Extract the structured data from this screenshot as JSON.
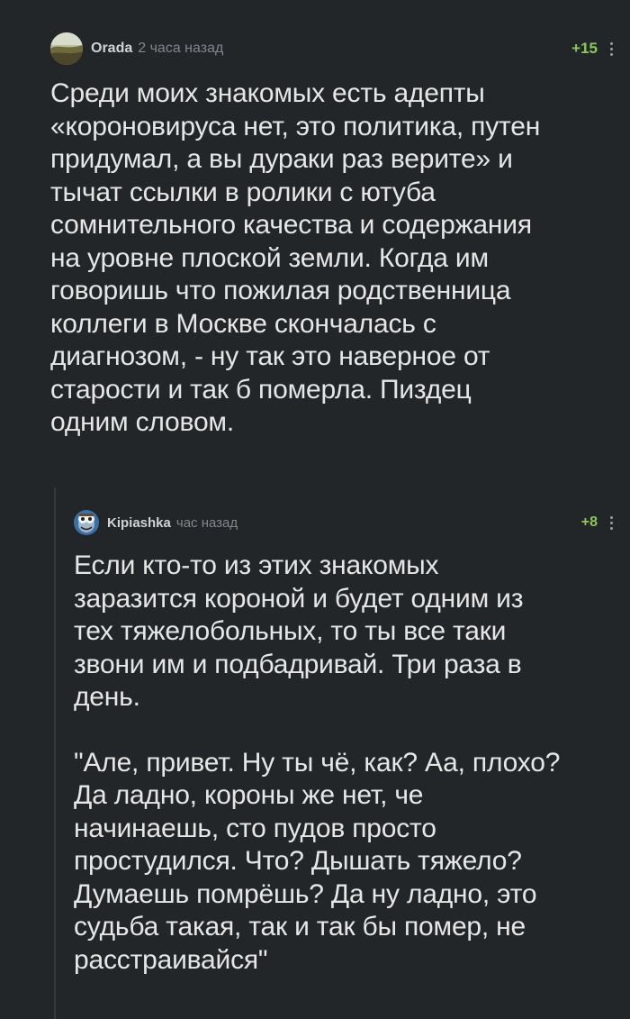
{
  "comments": [
    {
      "author": "Orada",
      "time": "2 часа назад",
      "rating": "+15",
      "avatar_icon": "landscape-avatar",
      "paragraphs": [
        "Среди моих знакомых есть адепты\n«короновируса нет, это политика, путен\nпридумал, а вы дураки раз верите» и\nтычат ссылки в ролики с ютуба\nсомнительного качества и содержания\nна уровне плоской земли. Когда им\nговоришь что пожилая родственница\nколлеги в Москве скончалась с\nдиагнозом, - ну так это наверное от\nстарости и так б померла. Пиздец\nодним словом."
      ]
    },
    {
      "author": "Kipiashka",
      "time": "час назад",
      "rating": "+8",
      "avatar_icon": "crazy-frog-avatar",
      "paragraphs": [
        "Если кто-то из этих знакомых\nзаразится короной и будет одним из\nтех тяжелобольных, то ты все таки\nзвони им и подбадривай. Три раза в\nдень.",
        "\"Але, привет. Ну ты чё, как? Аа, плохо?\nДа ладно, короны же нет, че\nначинаешь, сто пудов просто\nпростудился. Что? Дышать тяжело?\nДумаешь помрёшь? Да ну ладно, это\nсудьба такая, так и так бы помер, не\nрасстраивайся\""
      ]
    }
  ],
  "colors": {
    "background": "#232629",
    "text": "#e6e6e6",
    "rating": "#8ac858",
    "meta": "#81868b"
  }
}
